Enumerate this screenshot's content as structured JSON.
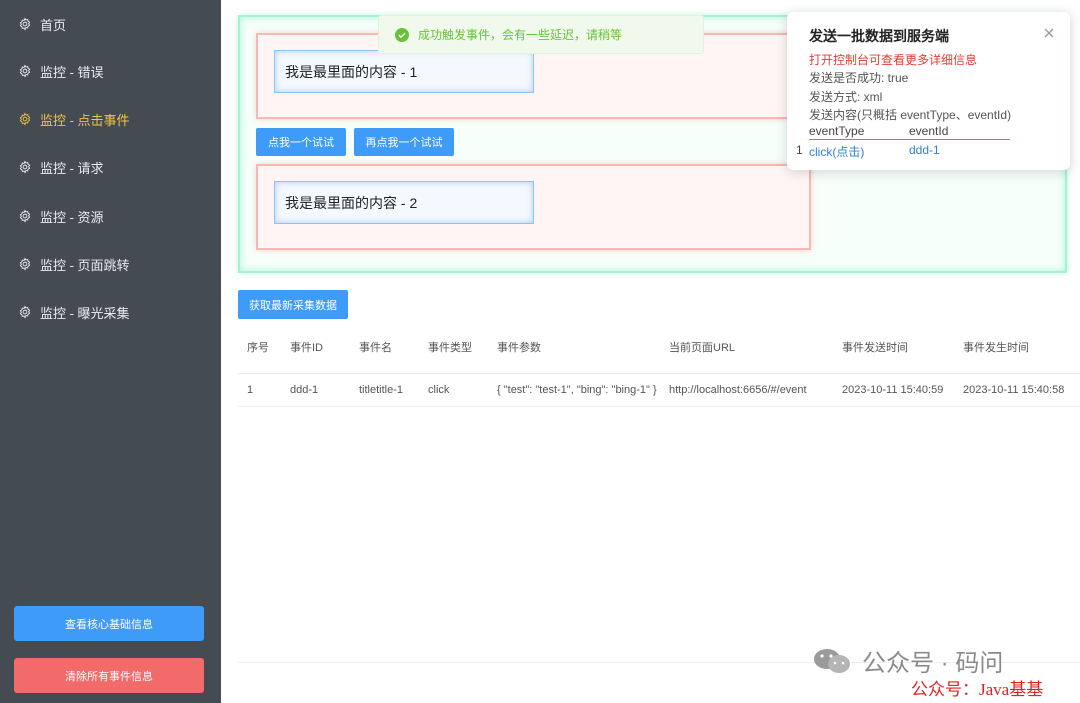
{
  "sidebar": {
    "items": [
      {
        "label": "首页"
      },
      {
        "label": "监控 - 错误"
      },
      {
        "label": "监控 - 点击事件"
      },
      {
        "label": "监控 - 请求"
      },
      {
        "label": "监控 - 资源"
      },
      {
        "label": "监控 - 页面跳转"
      },
      {
        "label": "监控 - 曝光采集"
      }
    ],
    "active_index": 2,
    "view_core_button": "查看核心基础信息",
    "clear_button": "清除所有事件信息"
  },
  "demo": {
    "content_1": "我是最里面的内容 - 1",
    "content_2": "我是最里面的内容 - 2",
    "click_button_1": "点我一个试试",
    "click_button_2": "再点我一个试试"
  },
  "toast": {
    "message": "成功触发事件，会有一些延迟，请稍等"
  },
  "notification": {
    "title": "发送一批数据到服务端",
    "hint": "打开控制台可查看更多详细信息",
    "success_line": "发送是否成功: true",
    "method_line": "发送方式: xml",
    "content_line": "发送内容(只概括 eventType、eventId)",
    "headers": [
      "eventType",
      "eventId"
    ],
    "rows": [
      {
        "index": "1",
        "eventType": "click(点击)",
        "eventId": "ddd-1"
      }
    ]
  },
  "fetch_button": "获取最新采集数据",
  "table": {
    "headers": [
      "序号",
      "事件ID",
      "事件名",
      "事件类型",
      "事件参数",
      "当前页面URL",
      "事件发送时间",
      "事件发生时间"
    ],
    "rows": [
      [
        "1",
        "ddd-1",
        "titletitle-1",
        "click",
        "{ \"test\": \"test-1\", \"bing\": \"bing-1\" }",
        "http://localhost:6656/#/event",
        "2023-10-11 15:40:59",
        "2023-10-11 15:40:58"
      ]
    ]
  },
  "watermark": {
    "line1": "公众号 · 码问",
    "line2": "公众号：Java基基"
  },
  "colors": {
    "sidebar_bg": "#444b51",
    "active": "#f0c24a",
    "primary": "#3f9bf8",
    "danger": "#f26a6a",
    "success": "#67c23a"
  }
}
